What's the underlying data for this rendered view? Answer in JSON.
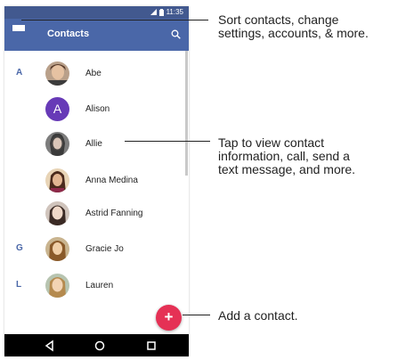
{
  "status_bar": {
    "time": "11:35",
    "signal_icon": "signal-icon",
    "battery_icon": "battery-icon"
  },
  "app_bar": {
    "title": "Contacts",
    "menu_icon": "menu-icon",
    "search_icon": "search-icon"
  },
  "contacts": [
    {
      "letter": "A",
      "name": "Abe",
      "avatar": "photo"
    },
    {
      "letter": "",
      "name": "Alison",
      "avatar": "letter",
      "avatar_letter": "A",
      "avatar_color": "#673ab7"
    },
    {
      "letter": "",
      "name": "Allie",
      "avatar": "photo"
    },
    {
      "letter": "",
      "name": "Anna Medina",
      "avatar": "photo"
    },
    {
      "letter": "",
      "name": "Astrid Fanning",
      "avatar": "photo"
    },
    {
      "letter": "G",
      "name": "Gracie Jo",
      "avatar": "photo"
    },
    {
      "letter": "L",
      "name": "Lauren",
      "avatar": "photo"
    }
  ],
  "fab": {
    "label": "+",
    "color": "#e53155"
  },
  "nav_bar": {
    "back_icon": "back-icon",
    "home_icon": "home-icon",
    "recents_icon": "recents-icon"
  },
  "callouts": {
    "menu": "Sort contacts, change\nsettings, accounts, & more.",
    "contact": "Tap to view contact\ninformation, call, send a\ntext message, and more.",
    "fab": "Add a contact."
  },
  "colors": {
    "status_bar": "#42598f",
    "app_bar": "#4a67a8",
    "accent": "#e53155",
    "section_letter": "#4a67a8"
  }
}
